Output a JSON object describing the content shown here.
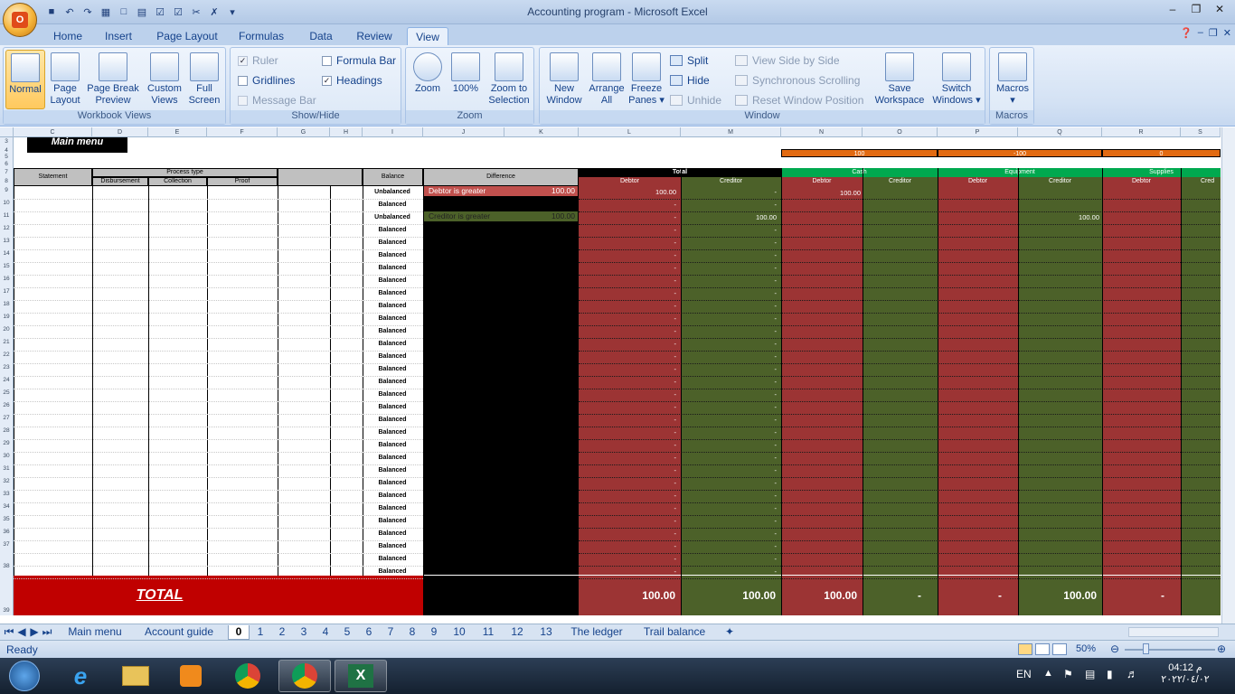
{
  "window": {
    "title": "Accounting program - Microsoft Excel"
  },
  "ribbon_tabs": [
    "Home",
    "Insert",
    "Page Layout",
    "Formulas",
    "Data",
    "Review",
    "View"
  ],
  "active_tab": "View",
  "groups": {
    "workbook_views": {
      "caption": "Workbook Views",
      "normal": "Normal",
      "page_layout_1": "Page",
      "page_layout_2": "Layout",
      "page_break_1": "Page Break",
      "page_break_2": "Preview",
      "custom_1": "Custom",
      "custom_2": "Views",
      "full_1": "Full",
      "full_2": "Screen"
    },
    "show_hide": {
      "caption": "Show/Hide",
      "ruler": "Ruler",
      "gridlines": "Gridlines",
      "message_bar": "Message Bar",
      "formula_bar": "Formula Bar",
      "headings": "Headings"
    },
    "zoom": {
      "caption": "Zoom",
      "zoom": "Zoom",
      "hundred": "100%",
      "sel_1": "Zoom to",
      "sel_2": "Selection"
    },
    "window": {
      "caption": "Window",
      "new_1": "New",
      "new_2": "Window",
      "arr_1": "Arrange",
      "arr_2": "All",
      "freeze_1": "Freeze",
      "freeze_2": "Panes",
      "split": "Split",
      "hide": "Hide",
      "unhide": "Unhide",
      "side": "View Side by Side",
      "sync": "Synchronous Scrolling",
      "reset": "Reset Window Position",
      "save_1": "Save",
      "save_2": "Workspace",
      "switch_1": "Switch",
      "switch_2": "Windows"
    },
    "macros": {
      "caption": "Macros",
      "macros": "Macros"
    }
  },
  "columns": [
    "C",
    "D",
    "E",
    "F",
    "G",
    "H",
    "I",
    "J",
    "K",
    "L",
    "M",
    "N",
    "O",
    "P",
    "Q",
    "R",
    "S"
  ],
  "rows": [
    "3",
    "4",
    "5",
    "6",
    "7",
    "8",
    "9",
    "10",
    "11",
    "12",
    "13",
    "14",
    "15",
    "16",
    "17",
    "18",
    "19",
    "20",
    "21",
    "22",
    "23",
    "24",
    "25",
    "26",
    "27",
    "28",
    "29",
    "30",
    "31",
    "32",
    "33",
    "34",
    "35",
    "36",
    "37",
    "38",
    "39",
    "40"
  ],
  "sheet": {
    "main_menu_btn": "Main menu",
    "header_row4": [
      "100",
      "-100",
      "0"
    ],
    "statement": "Statement",
    "process_type": "Process type",
    "disbursement": "Disbursement",
    "collection": "Collection",
    "proof": "Proof",
    "balance": "Balance",
    "difference": "Difference",
    "total": "Total",
    "cash": "Cash",
    "equipment": "Equipment",
    "supplies": "Supplies",
    "debtor": "Debtor",
    "creditor": "Creditor",
    "cred_partial": "Cred",
    "debtor_greater": "Debtor is greater",
    "creditor_greater": "Creditor is greater",
    "diff_value": "100.00",
    "balances": [
      "Unbalanced",
      "Balanced",
      "Unbalanced",
      "Balanced",
      "Balanced",
      "Balanced",
      "Balanced",
      "Balanced",
      "Balanced",
      "Balanced",
      "Balanced",
      "Balanced",
      "Balanced",
      "Balanced",
      "Balanced",
      "Balanced",
      "Balanced",
      "Balanced",
      "Balanced",
      "Balanced",
      "Balanced",
      "Balanced",
      "Balanced",
      "Balanced",
      "Balanced",
      "Balanced",
      "Balanced",
      "Balanced",
      "Balanced",
      "Balanced",
      "Balanced"
    ],
    "debtor_vals": [
      "100.00",
      "-",
      "-",
      "-",
      "-",
      "-",
      "-",
      "-",
      "-",
      "-",
      "-",
      "-",
      "-",
      "-",
      "-",
      "-",
      "-",
      "-",
      "-",
      "-",
      "-",
      "-",
      "-",
      "-",
      "-",
      "-",
      "-",
      "-",
      "-",
      "-",
      "-"
    ],
    "creditor_vals": [
      "-",
      "-",
      "100.00",
      "-",
      "-",
      "-",
      "-",
      "-",
      "-",
      "-",
      "-",
      "-",
      "-",
      "-",
      "-",
      "-",
      "-",
      "-",
      "-",
      "-",
      "-",
      "-",
      "-",
      "-",
      "-",
      "-",
      "-",
      "-",
      "-",
      "-",
      "-"
    ],
    "cash_debtor_r8": "100.00",
    "equip_creditor_r10": "100.00",
    "total_label": "TOTAL",
    "totals": [
      "100.00",
      "100.00",
      "100.00",
      "-",
      "-",
      "100.00",
      "-"
    ]
  },
  "sheet_tabs": [
    "Main menu",
    "Account guide",
    "0",
    "1",
    "2",
    "3",
    "4",
    "5",
    "6",
    "7",
    "8",
    "9",
    "10",
    "11",
    "12",
    "13",
    "The ledger",
    "Trail balance"
  ],
  "active_sheet": "0",
  "status": {
    "ready": "Ready",
    "zoom": "50%"
  },
  "taskbar": {
    "lang": "EN",
    "time": "04:12 م",
    "date": "٢٠٢٢/٠٤/٠٢"
  }
}
